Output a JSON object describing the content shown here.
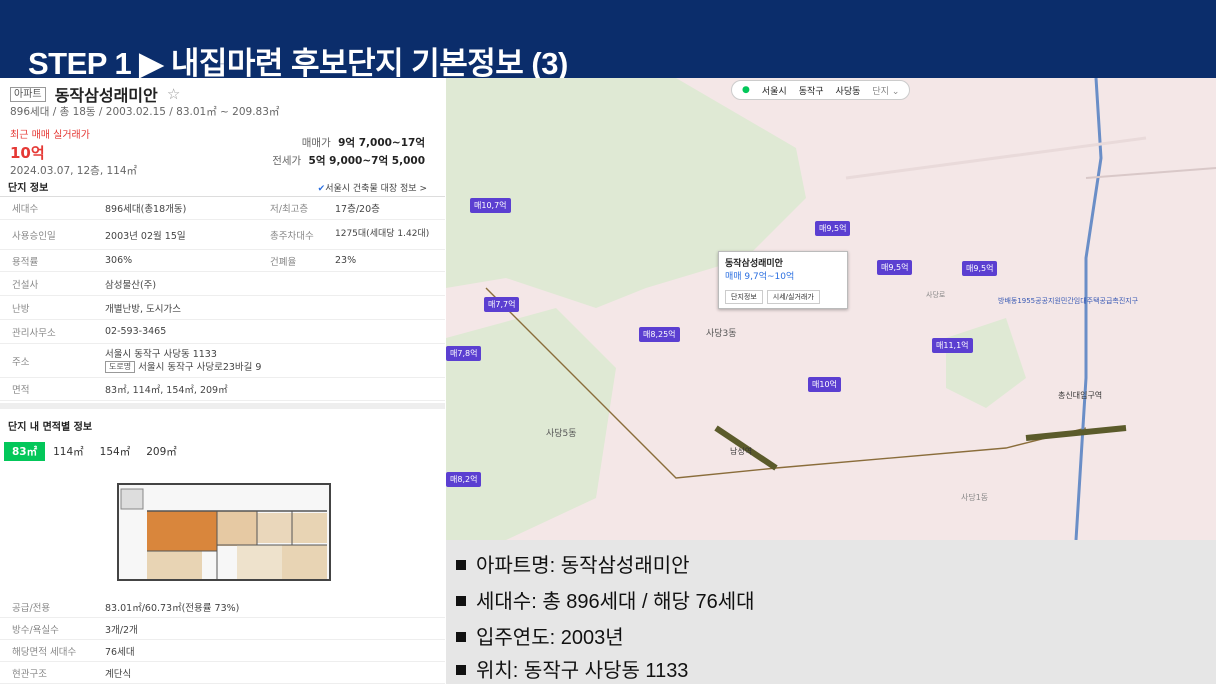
{
  "header": {
    "title": "STEP 1 ▶ 내집마련 후보단지 기본정보 (3)"
  },
  "apt": {
    "badge": "아파트",
    "name": "동작삼성래미안",
    "meta": "896세대 / 총 18동 / 2003.02.15 / 83.01㎡ ~ 209.83㎡",
    "recent_label": "최근 매매 실거래가",
    "recent_price": "10억",
    "recent_info": "2024.03.07, 12층, 114㎡",
    "sale_label": "매매가",
    "sale_value": "9억 7,000~17억",
    "jeonse_label": "전세가",
    "jeonse_value": "5억 9,000~7억 5,000"
  },
  "info": {
    "heading": "단지 정보",
    "link": "서울시 건축물 대장 정보 >",
    "rows": [
      {
        "k": "세대수",
        "v": "896세대(총18개동)",
        "k2": "저/최고층",
        "v2": "17층/20층"
      },
      {
        "k": "사용승인일",
        "v": "2003년 02월 15일",
        "k2": "총주차대수",
        "v2": "1275대(세대당 1.42대)"
      },
      {
        "k": "용적률",
        "v": "306%",
        "k2": "건폐율",
        "v2": "23%"
      },
      {
        "k": "건설사",
        "v": "삼성물산(주)"
      },
      {
        "k": "난방",
        "v": "개별난방, 도시가스"
      },
      {
        "k": "관리사무소",
        "v": "02-593-3465"
      },
      {
        "k": "주소",
        "v": "서울시 동작구 사당동 1133",
        "road_badge": "도로명",
        "road": "서울시 동작구 사당로23바길 9"
      },
      {
        "k": "면적",
        "v": "83㎡, 114㎡, 154㎡, 209㎡"
      }
    ]
  },
  "area": {
    "heading": "단지 내 면적별 정보",
    "tabs": [
      "83㎡",
      "114㎡",
      "154㎡",
      "209㎡"
    ],
    "rows": [
      {
        "k": "공급/전용",
        "v": "83.01㎡/60.73㎡(전용률 73%)"
      },
      {
        "k": "방수/욕실수",
        "v": "3개/2개"
      },
      {
        "k": "해당면적 세대수",
        "v": "76세대"
      },
      {
        "k": "현관구조",
        "v": "계단식"
      }
    ]
  },
  "map": {
    "breadcrumb": [
      "서울시",
      "동작구",
      "사당동",
      "단지"
    ],
    "popup": {
      "name": "동작삼성래미안",
      "price": "매매 9,7억~10억",
      "btn1": "단지정보",
      "btn2": "시세/실거래가"
    },
    "pins": [
      "매10,7억",
      "매9,5억",
      "매9,5억",
      "매9,5억",
      "매7,7억",
      "매8,25억",
      "매11,1억",
      "매10억",
      "매8,2억",
      "매7,8억"
    ],
    "labels": [
      "사당3동",
      "사당5동",
      "사당1동",
      "남성역",
      "총신대입구역",
      "사당로",
      "방배동1955공공지원민간임대주택공급촉진지구"
    ]
  },
  "bullets": [
    "아파트명: 동작삼성래미안",
    "세대수: 총 896세대 / 해당 76세대",
    "입주연도: 2003년",
    "위치: 동작구 사당동 1133"
  ]
}
